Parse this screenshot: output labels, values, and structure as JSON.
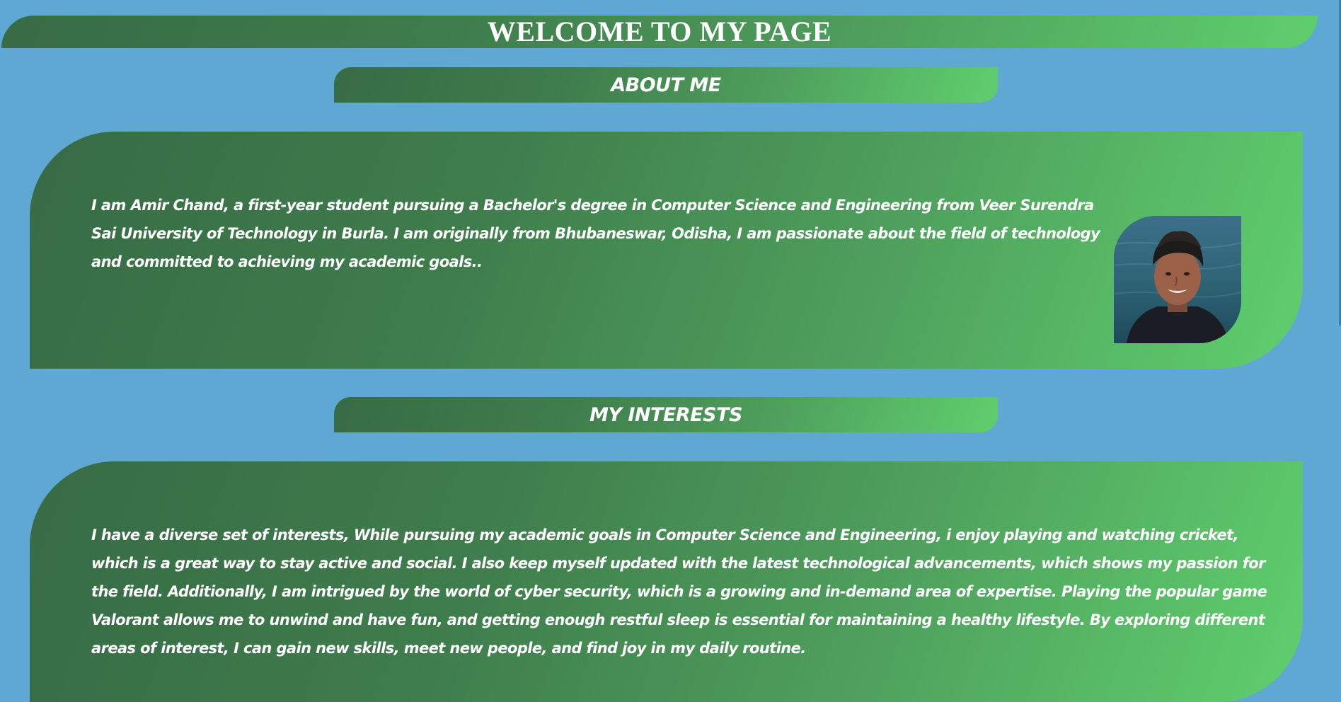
{
  "header": {
    "title": "WELCOME TO MY PAGE"
  },
  "about": {
    "heading": "ABOUT ME",
    "text": "I am Amir Chand, a first-year student pursuing a Bachelor's degree in Computer Science and Engineering from Veer Surendra Sai University of Technology in Burla. I am originally from Bhubaneswar, Odisha, I am passionate about the field of technology and committed to achieving my academic goals..",
    "photo_icon": "profile-photo"
  },
  "interests": {
    "heading": "MY INTERESTS",
    "text": "I have a diverse set of interests, While pursuing my academic goals in Computer Science and Engineering, i enjoy playing and watching cricket, which is a great way to stay active and social. I also keep myself updated with the latest technological advancements, which shows my passion for the field. Additionally, I am intrigued by the world of cyber security, which is a growing and in-demand area of expertise. Playing the popular game Valorant allows me to unwind and have fun, and getting enough restful sleep is essential for maintaining a healthy lifestyle. By exploring different areas of interest, I can gain new skills, meet new people, and find joy in my daily routine."
  },
  "colors": {
    "background": "#5fa8d3",
    "gradient_start": "#376b45",
    "gradient_end": "#5fcf6d",
    "text": "#ffffff"
  }
}
